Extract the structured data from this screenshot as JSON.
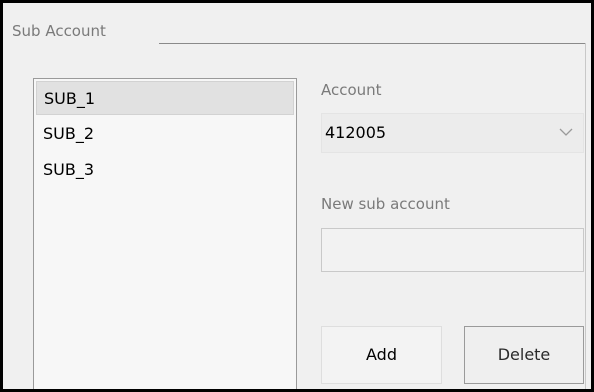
{
  "group": {
    "title": "Sub Account"
  },
  "sub_accounts": {
    "items": [
      {
        "label": "SUB_1",
        "selected": true
      },
      {
        "label": "SUB_2",
        "selected": false
      },
      {
        "label": "SUB_3",
        "selected": false
      }
    ]
  },
  "account": {
    "label": "Account",
    "value": "412005",
    "dropdown_icon": "chevron-down-icon"
  },
  "new_sub_account": {
    "label": "New sub account",
    "value": "",
    "placeholder": ""
  },
  "buttons": {
    "add_label": "Add",
    "delete_label": "Delete"
  },
  "colors": {
    "background": "#f0f0f0",
    "window_border": "#000000",
    "label_gray": "#7a7a7a",
    "selected_item": "#e1e1e1"
  }
}
